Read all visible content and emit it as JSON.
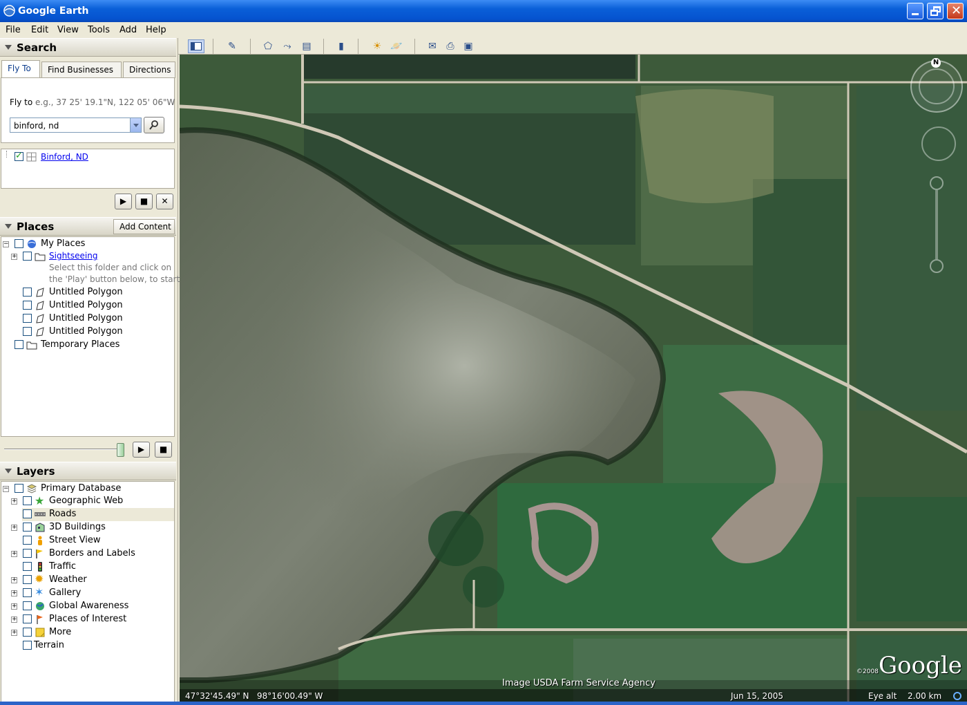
{
  "window": {
    "title": "Google Earth"
  },
  "menu": [
    "File",
    "Edit",
    "View",
    "Tools",
    "Add",
    "Help"
  ],
  "search": {
    "header": "Search",
    "tabs": [
      "Fly To",
      "Find Businesses",
      "Directions"
    ],
    "fly_to_label": "Fly to",
    "fly_to_hint": "e.g., 37 25' 19.1\"N, 122 05' 06\"W",
    "input_value": "binford, nd",
    "result": "Binford, ND"
  },
  "places": {
    "header": "Places",
    "add_content": "Add Content",
    "my_places": "My Places",
    "sightseeing": "Sightseeing",
    "sightseeing_hint_1": "Select this folder and click on",
    "sightseeing_hint_2": "the 'Play' button below, to start",
    "polygons": [
      "Untitled Polygon",
      "Untitled Polygon",
      "Untitled Polygon",
      "Untitled Polygon"
    ],
    "temporary": "Temporary Places"
  },
  "layers": {
    "header": "Layers",
    "primary": "Primary Database",
    "items": [
      "Geographic Web",
      "Roads",
      "3D Buildings",
      "Street View",
      "Borders and Labels",
      "Traffic",
      "Weather",
      "Gallery",
      "Global Awareness",
      "Places of Interest",
      "More"
    ],
    "terrain": "Terrain"
  },
  "map": {
    "compass_n": "N",
    "attribution": "Image USDA Farm Service Agency",
    "latitude": "47°32'45.49\" N",
    "longitude": "98°16'00.49\" W",
    "date": "Jun 15, 2005",
    "eye_alt_label": "Eye alt",
    "eye_alt_value": "2.00 km",
    "logo_year": "©2008",
    "logo_text": "Google"
  }
}
